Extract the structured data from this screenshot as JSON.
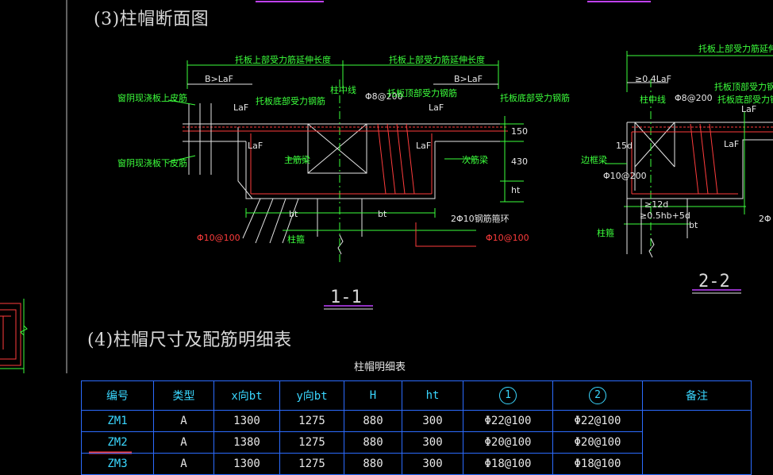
{
  "drawing": {
    "title_section_3": "(3)柱帽断面图",
    "title_section_4": "(4)柱帽尺寸及配筋明细表",
    "section_1_label": "1-1",
    "section_2_label": "2-2",
    "labels_1_1": {
      "top_anchor_left": "托板上部受力筋延伸长度",
      "top_anchor_right": "托板上部受力筋延伸长度",
      "b_laf_left": "B>LaF",
      "b_laf_right": "B>LaF",
      "slab_top_bar": "窗阴现浇板上皮筋",
      "slab_bottom_bar": "窗阴现浇板下皮筋",
      "laf_1": "LaF",
      "laf_2": "LaF",
      "laf_3": "LaF",
      "laf_4": "LaF",
      "bottom_bar_left": "托板底部受力钢筋",
      "center_line": "柱中线",
      "stirrup_top": "Φ8@200",
      "top_bar_mid": "托板顶部受力钢筋",
      "bottom_bar_right": "托板底部受力钢筋",
      "main_beam": "主筋梁",
      "sub_beam": "次筋梁",
      "dim_150": "150",
      "dim_430": "430",
      "dim_ht": "ht",
      "bt_1": "bt",
      "bt_2": "bt",
      "ring_bar": "2Φ10钢筋箍环",
      "col_stirrup_left": "Φ10@100",
      "col_stirrup_right": "Φ10@100",
      "column": "柱箍"
    },
    "labels_2_2": {
      "top_anchor": "托板上部受力筋延伸长度",
      "laf_04": "≥0.4LaF",
      "center_line": "柱中线",
      "stirrup_top": "Φ8@200",
      "top_bar": "托板顶部受力钢筋",
      "bottom_bar": "托板底部受力钢筋",
      "laf_1": "LaF",
      "laf_2": "LaF",
      "dim_15d": "15d",
      "edge_beam": "边框梁",
      "stirrup": "Φ10@200",
      "dim_12d": "≥12d",
      "dim_05hb": "≥0.5hb+5d",
      "bt": "bt",
      "ring_bar": "2Φ",
      "column": "柱箍"
    }
  },
  "table": {
    "caption": "柱帽明细表",
    "headers": [
      "编号",
      "类型",
      "x向bt",
      "y向bt",
      "H",
      "ht",
      "1",
      "2",
      "备注"
    ],
    "rows": [
      [
        "ZM1",
        "A",
        "1300",
        "1275",
        "880",
        "300",
        "Φ22@100",
        "Φ22@100",
        ""
      ],
      [
        "ZM2",
        "A",
        "1380",
        "1275",
        "880",
        "300",
        "Φ20@100",
        "Φ20@100",
        ""
      ],
      [
        "ZM3",
        "A",
        "1300",
        "1275",
        "880",
        "300",
        "Φ18@100",
        "Φ18@100",
        ""
      ]
    ]
  },
  "colors": {
    "background": "#000000",
    "green_text": "#3cff3c",
    "rebar_red": "#ff3c3c",
    "table_border": "#2c6cff",
    "table_header": "#3ad7ff",
    "magenta_underline": "#c040ff"
  }
}
